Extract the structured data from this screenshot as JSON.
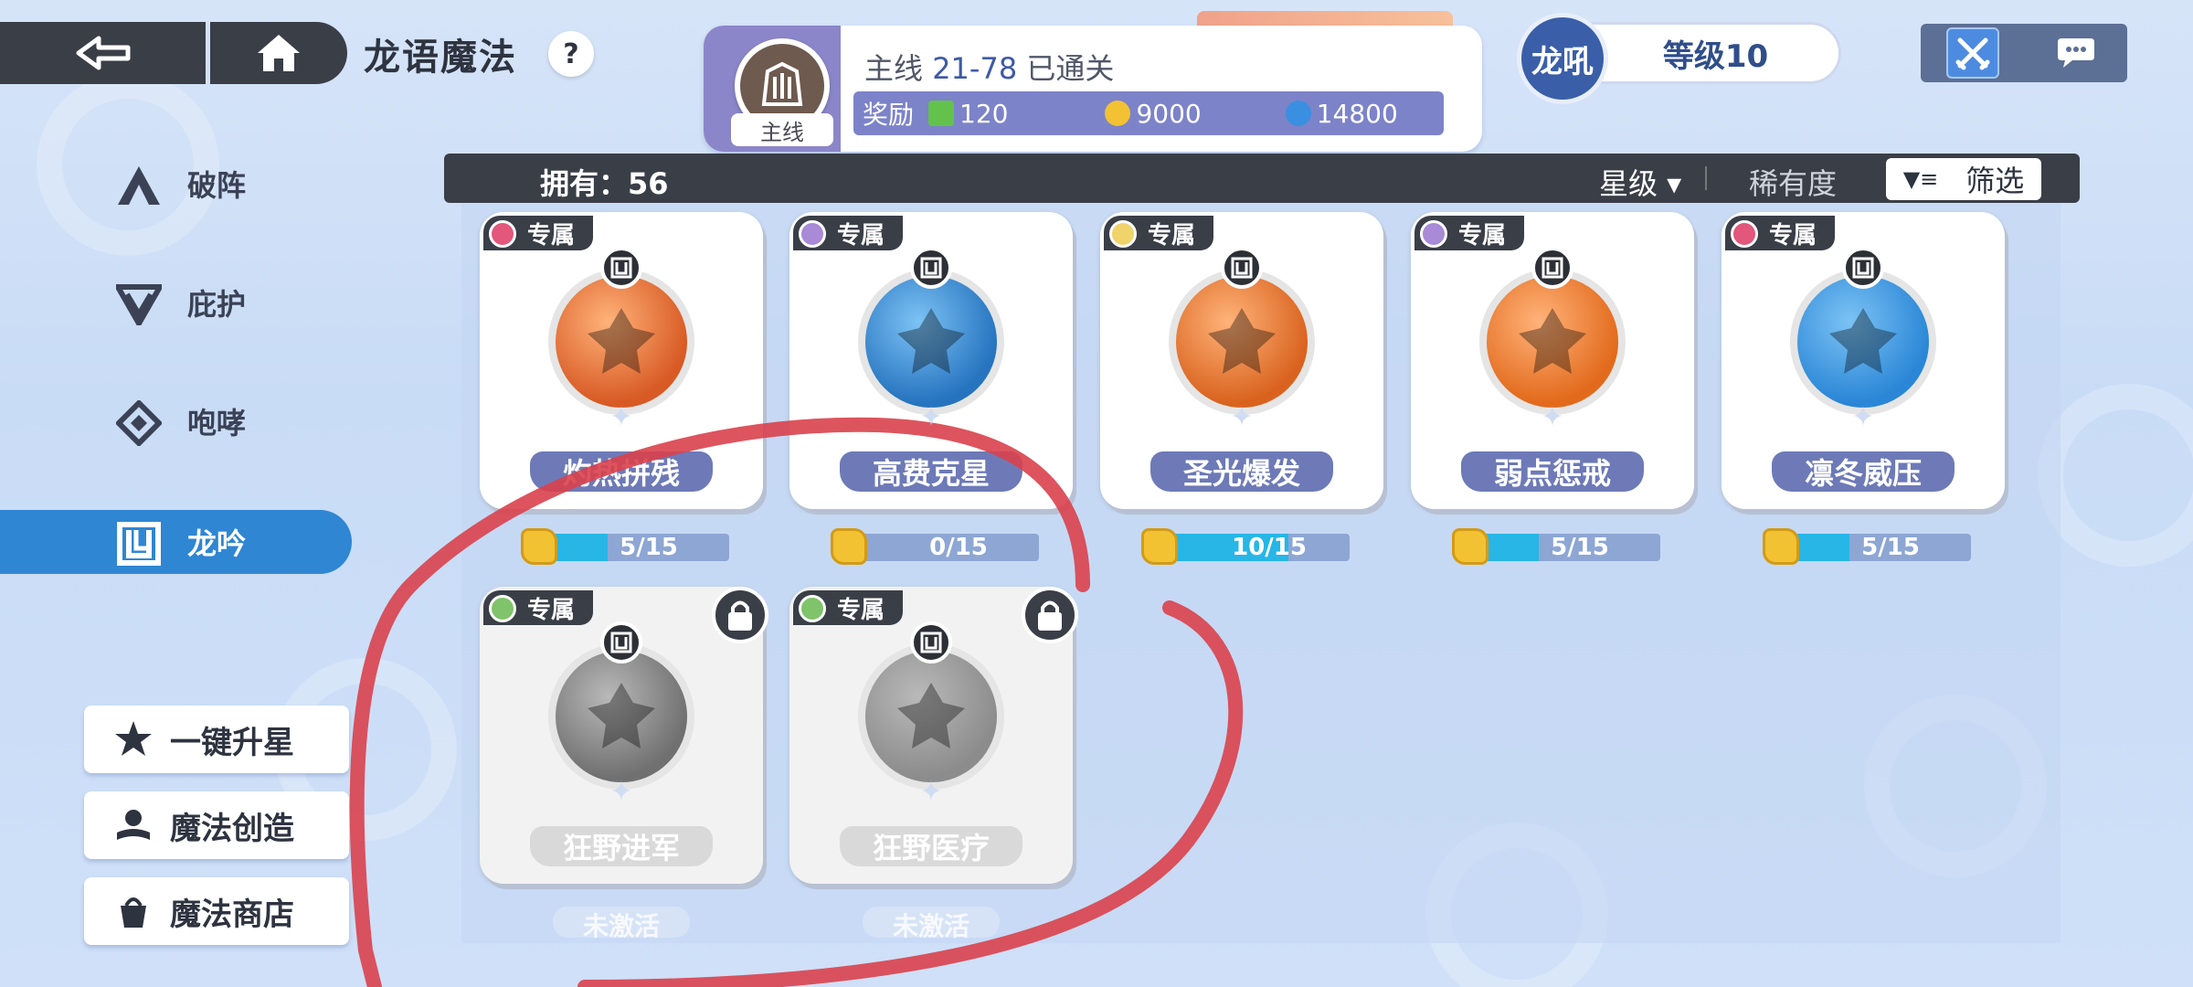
{
  "header": {
    "title": "龙语魔法",
    "help": "?"
  },
  "quest": {
    "emblem_label": "主线",
    "status_prefix": "主线",
    "status_nums": "21-78",
    "status_suffix": "已通关",
    "reward_label": "奖励",
    "rewards": [
      {
        "icon": "green-gem-icon",
        "value": "120",
        "color": "#63c24c"
      },
      {
        "icon": "gold-coin-icon",
        "value": "9000",
        "color": "#f2c233"
      },
      {
        "icon": "blue-crystal-icon",
        "value": "14800",
        "color": "#3a8fe0"
      }
    ]
  },
  "level": {
    "badge": "龙吼",
    "label": "等级10"
  },
  "nav": {
    "items": [
      {
        "label": "破阵",
        "icon": "break-formation-icon"
      },
      {
        "label": "庇护",
        "icon": "shelter-icon"
      },
      {
        "label": "咆哮",
        "icon": "roar-icon"
      },
      {
        "label": "龙吟",
        "icon": "dragon-chant-icon",
        "active": true
      }
    ]
  },
  "actions": [
    {
      "label": "一键升星",
      "icon": "star-up-icon"
    },
    {
      "label": "魔法创造",
      "icon": "magic-create-icon"
    },
    {
      "label": "魔法商店",
      "icon": "magic-shop-icon"
    }
  ],
  "list": {
    "owned": "拥有：56",
    "sort_star": "星级 ▾",
    "sort_rarity": "稀有度",
    "filter": "筛选"
  },
  "cards": [
    {
      "tag": "专属",
      "name": "灼热拼残",
      "progress": "5/15",
      "ratio": 0.333,
      "element_color": "#e2577b",
      "orb": "#d85a24",
      "locked": false
    },
    {
      "tag": "专属",
      "name": "高费克星",
      "progress": "0/15",
      "ratio": 0.0,
      "element_color": "#a88ad6",
      "orb": "#2673bf",
      "locked": false
    },
    {
      "tag": "专属",
      "name": "圣光爆发",
      "progress": "10/15",
      "ratio": 0.667,
      "element_color": "#f0d36b",
      "orb": "#d9631e",
      "locked": false
    },
    {
      "tag": "专属",
      "name": "弱点惩戒",
      "progress": "5/15",
      "ratio": 0.333,
      "element_color": "#a88ad6",
      "orb": "#e26a1c",
      "locked": false
    },
    {
      "tag": "专属",
      "name": "凛冬威压",
      "progress": "5/15",
      "ratio": 0.333,
      "element_color": "#e2577b",
      "orb": "#2a86d6",
      "locked": false
    },
    {
      "tag": "专属",
      "name": "狂野进军",
      "status": "未激活",
      "element_color": "#7fc36a",
      "orb": "#707070",
      "locked": true
    },
    {
      "tag": "专属",
      "name": "狂野医疗",
      "status": "未激活",
      "element_color": "#7fc36a",
      "orb": "#8c8c8c",
      "locked": true
    }
  ],
  "colors": {
    "accent": "#2f86d3",
    "dark": "#3a3e47",
    "annotation": "#d9414d"
  }
}
